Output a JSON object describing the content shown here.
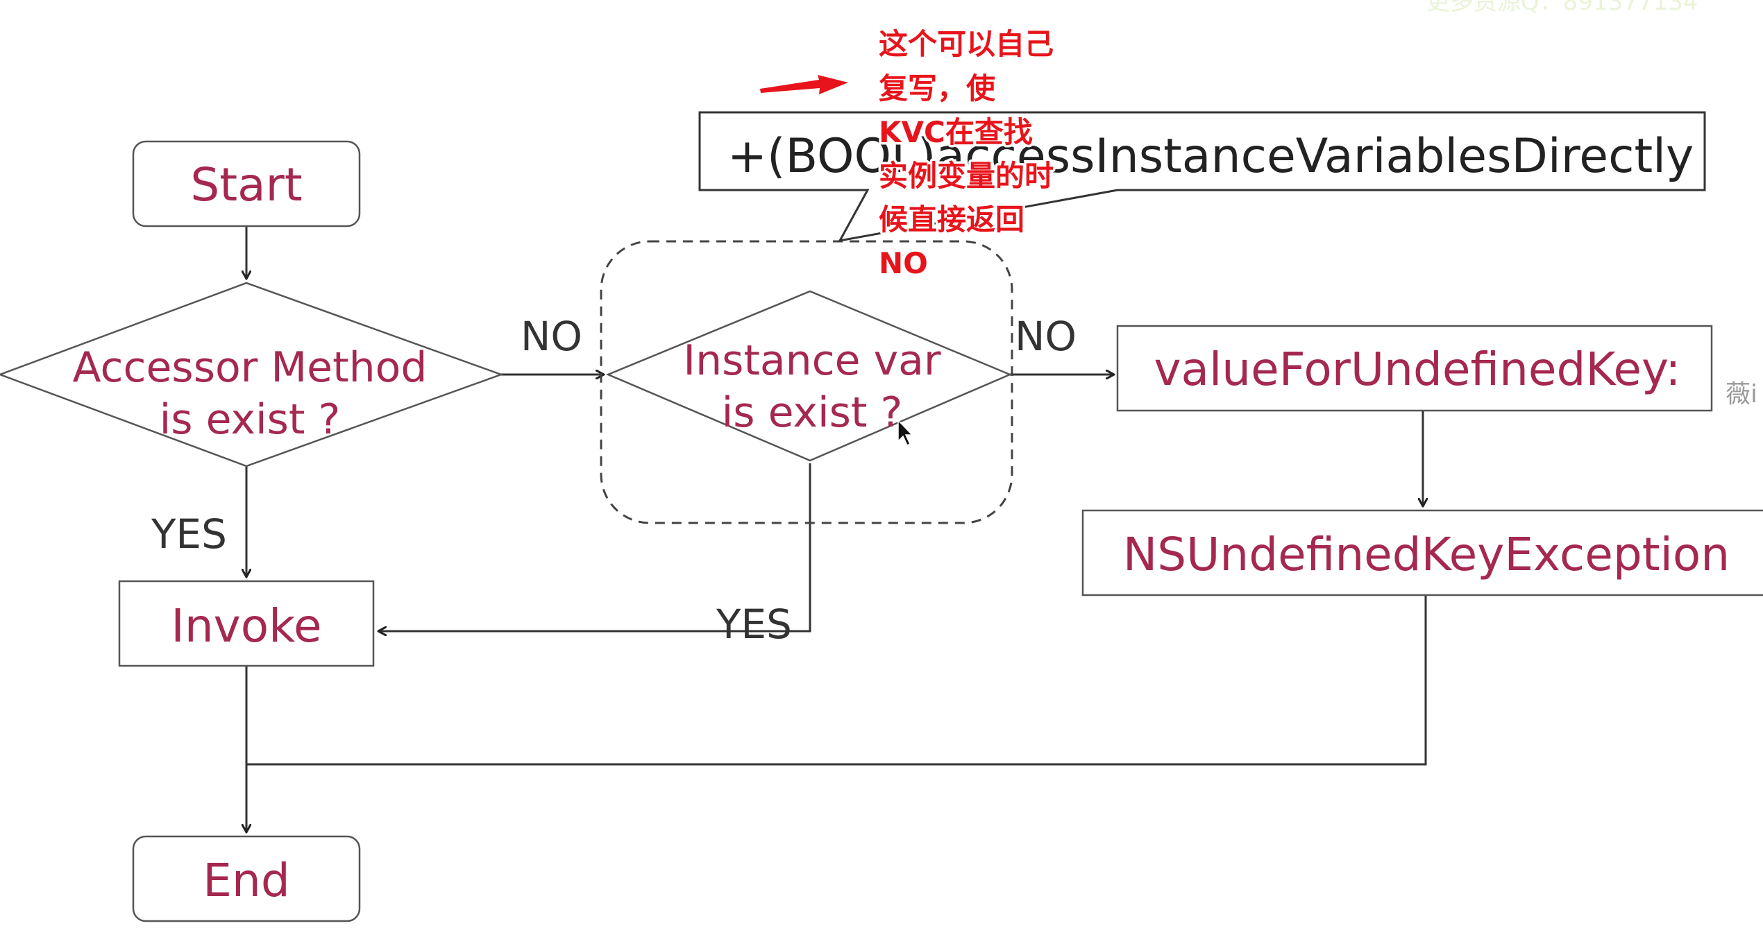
{
  "watermark": "更多资源Q：891377134",
  "side_fragment": "薇i",
  "nodes": {
    "start": "Start",
    "accessor_line1": "Accessor Method",
    "accessor_line2": "is exist ?",
    "instance_line1": "Instance var",
    "instance_line2": "is exist ?",
    "invoke": "Invoke",
    "value_for_undefined": "valueForUndefinedKey:",
    "exception": "NSUndefinedKeyException",
    "end": "End"
  },
  "edge_labels": {
    "no_1": "NO",
    "no_2": "NO",
    "yes_1": "YES",
    "yes_2": "YES"
  },
  "callout": {
    "text": "+(BOOL)accessInstanceVariablesDirectly"
  },
  "annotation": {
    "lines": [
      "这个可以自己",
      "复写，使",
      "KVC在查找",
      "实例变量的时",
      "候直接返回",
      "NO"
    ],
    "color": "#e8141b"
  },
  "colors": {
    "node_text": "#a5284f",
    "stroke": "#333333"
  }
}
